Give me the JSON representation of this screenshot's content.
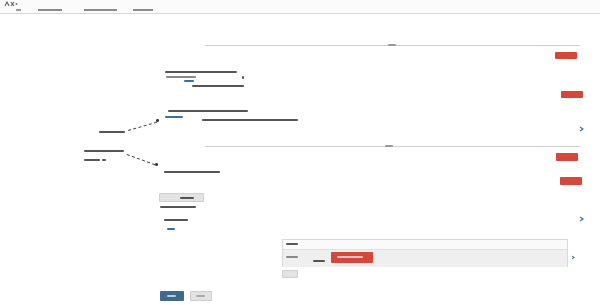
{
  "header": {
    "tabs": [
      "",
      "",
      "",
      ""
    ]
  },
  "sections": [
    {
      "action_label": "",
      "secondary_label": ""
    },
    {
      "action_label": "",
      "secondary_label": ""
    }
  ],
  "form": {
    "add_button_label": "",
    "save_label": "",
    "cancel_label": "",
    "row_label": "",
    "row_action_label": "",
    "panel_title": "",
    "small_button_label": ""
  },
  "colors": {
    "accent_red": "#d6463a",
    "primary_blue": "#3f6a8c",
    "link_blue": "#3a6fa8"
  },
  "icons": [
    "share-icon",
    "link-icon",
    "chevron-right-icon"
  ]
}
